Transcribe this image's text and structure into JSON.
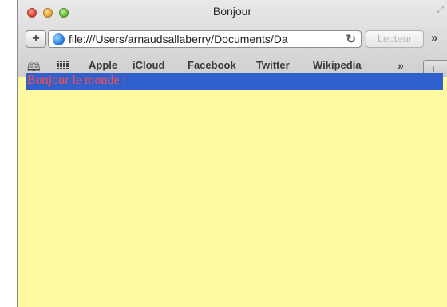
{
  "window": {
    "title": "Bonjour"
  },
  "toolbar": {
    "add_label": "+",
    "url": "file:///Users/arnaudsallaberry/Documents/Da",
    "reader_label": "Lecteur",
    "more_label": "»"
  },
  "bookmarks": {
    "items": [
      "Apple",
      "iCloud",
      "Facebook",
      "Twitter",
      "Wikipedia"
    ],
    "more_label": "»",
    "newtab_label": "+"
  },
  "page": {
    "heading": "Bonjour le monde !",
    "colors": {
      "background": "#fff9a0",
      "heading_bg": "#3060cc",
      "heading_text": "#ff4d4d"
    }
  }
}
